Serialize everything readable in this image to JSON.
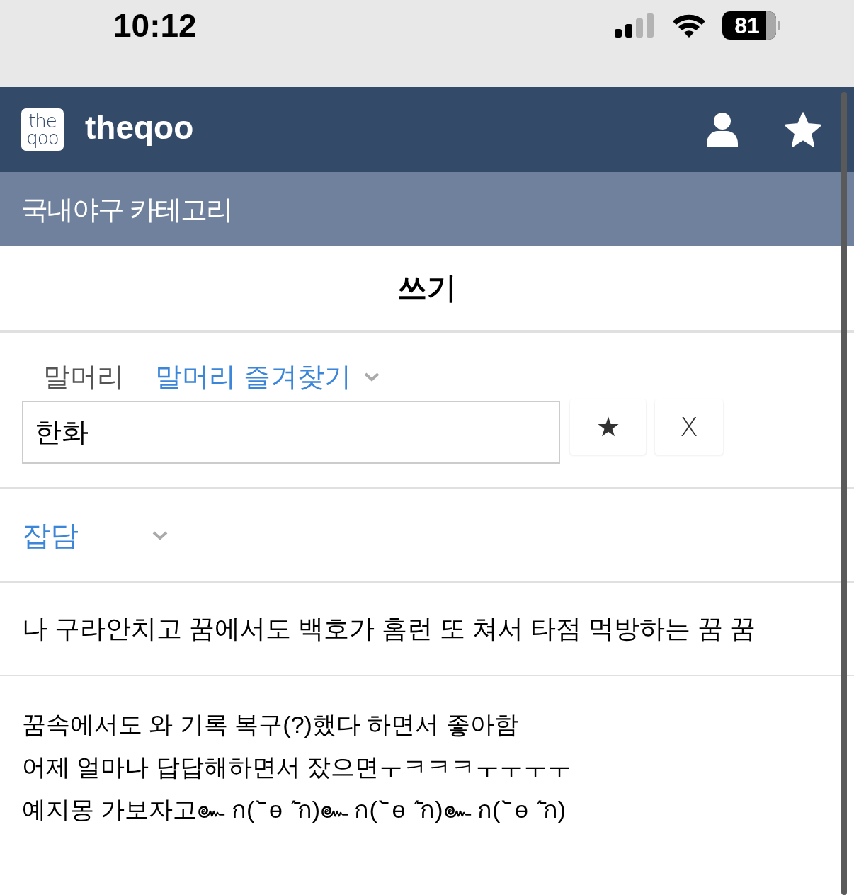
{
  "status_bar": {
    "time": "10:12",
    "battery": "81"
  },
  "header": {
    "logo_lines": [
      "the",
      "qoo"
    ],
    "site_name": "theqoo"
  },
  "category_bar": {
    "title": "국내야구 카테고리"
  },
  "page_title": "쓰기",
  "prefix": {
    "label": "말머리",
    "favorites_link": "말머리 즐겨찾기",
    "value": "한화",
    "star_button": "★",
    "clear_button": "X"
  },
  "category_select": {
    "value": "잡담"
  },
  "post_title": {
    "value": "나 구라안치고 꿈에서도 백호가 홈런 또 쳐서 타점 먹방하는 꿈 꿈"
  },
  "post_body": {
    "lines": [
      "꿈속에서도 와 기록 복구(?)했다 하면서 좋아함",
      "어제 얼마나 답답해하면서 잤으면ㅜㅋㅋㅋㅜㅜㅜㅜ",
      "예지몽 가보자고๛ ก(ˋ̄ ө ˊ̄ก)๛ ก(ˋ̄ ө ˊ̄ก)๛ ก(ˋ̄ ө ˊ̄ก)"
    ]
  }
}
